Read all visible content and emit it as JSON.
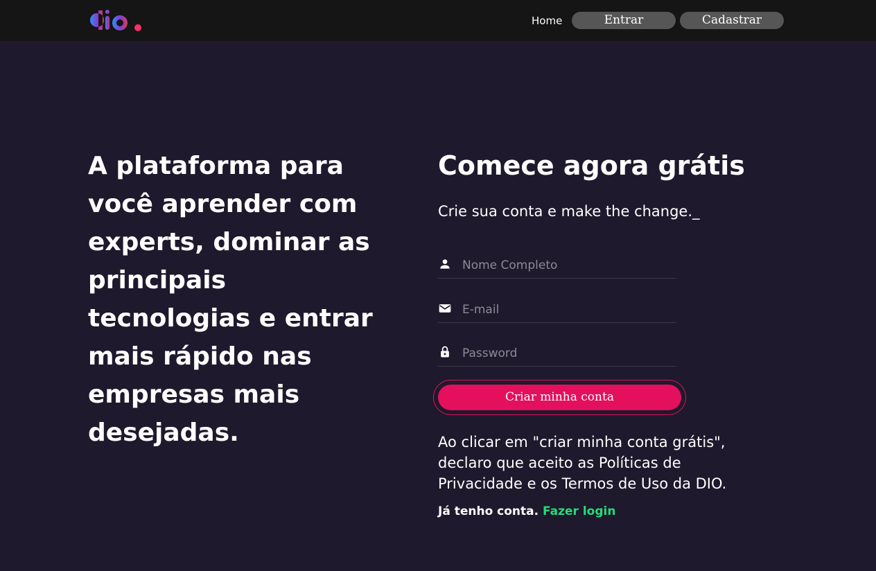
{
  "header": {
    "logo_text": "dio.",
    "nav": {
      "home": "Home",
      "entrar": "Entrar",
      "cadastrar": "Cadastrar"
    }
  },
  "hero": {
    "title": "A plataforma para você aprender com experts, dominar as principais tecnologias e entrar mais rápido nas empresas mais desejadas."
  },
  "signup": {
    "title": "Comece agora grátis",
    "subtitle": "Crie sua conta e make the change._",
    "fields": {
      "name": {
        "placeholder": "Nome Completo",
        "icon": "person-icon",
        "value": ""
      },
      "email": {
        "placeholder": "E-mail",
        "icon": "mail-icon",
        "value": ""
      },
      "password": {
        "placeholder": "Password",
        "icon": "lock-icon",
        "value": ""
      }
    },
    "submit_label": "Criar minha conta",
    "terms": "Ao clicar em \"criar minha conta grátis\", declaro que aceito as Políticas de Privacidade e os Termos de Uso da DIO.",
    "have_account": "Já tenho conta.",
    "login_link": "Fazer login"
  },
  "colors": {
    "background": "#1e192c",
    "topbar": "#151515",
    "nav_button": "#565656",
    "accent": "#e4105d",
    "link_green": "#23dd7a"
  }
}
